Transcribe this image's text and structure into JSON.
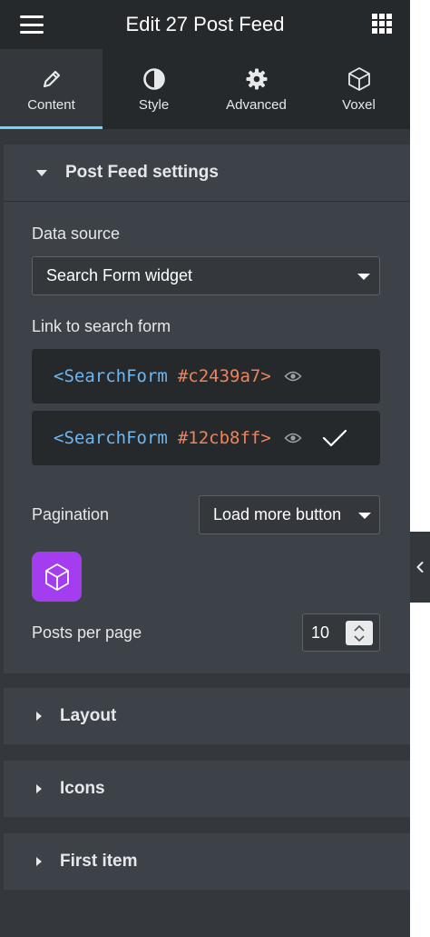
{
  "header": {
    "title": "Edit 27 Post Feed",
    "menu_icon": "hamburger-icon",
    "apps_icon": "grid-icon"
  },
  "tabs": [
    {
      "label": "Content",
      "icon": "pencil-icon",
      "active": true
    },
    {
      "label": "Style",
      "icon": "half-circle-icon",
      "active": false
    },
    {
      "label": "Advanced",
      "icon": "gear-icon",
      "active": false
    },
    {
      "label": "Voxel",
      "icon": "cube-icon",
      "active": false
    }
  ],
  "post_feed": {
    "title": "Post Feed settings",
    "data_source": {
      "label": "Data source",
      "value": "Search Form widget"
    },
    "link_search_form": {
      "label": "Link to search form",
      "items": [
        {
          "tag": "<SearchForm",
          "hash": "#c2439a7>",
          "selected": false
        },
        {
          "tag": "<SearchForm",
          "hash": "#12cb8ff>",
          "selected": true
        }
      ]
    },
    "pagination": {
      "label": "Pagination",
      "value": "Load more button"
    },
    "posts_per_page": {
      "label": "Posts per page",
      "value": "10"
    }
  },
  "sections": {
    "layout": "Layout",
    "icons": "Icons",
    "first_item": "First item"
  },
  "colors": {
    "accent": "#71d7f7",
    "voxel_purple": "#a43cf0",
    "code_tag": "#6fb7f0",
    "code_hash": "#f0835a"
  }
}
